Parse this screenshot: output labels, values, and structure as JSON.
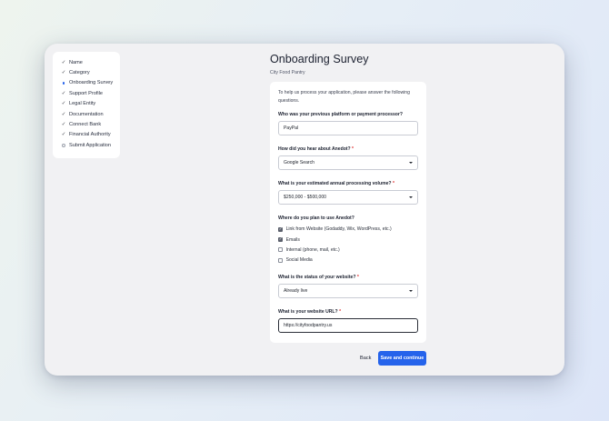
{
  "sidebar": {
    "steps": [
      {
        "label": "Name",
        "state": "done"
      },
      {
        "label": "Category",
        "state": "done"
      },
      {
        "label": "Onboarding Survey",
        "state": "current"
      },
      {
        "label": "Support Profile",
        "state": "done"
      },
      {
        "label": "Legal Entity",
        "state": "done"
      },
      {
        "label": "Documentation",
        "state": "done"
      },
      {
        "label": "Connect Bank",
        "state": "done"
      },
      {
        "label": "Financial Authority",
        "state": "done"
      },
      {
        "label": "Submit Application",
        "state": "pending"
      }
    ]
  },
  "header": {
    "title": "Onboarding Survey",
    "subtitle": "City Food Pantry"
  },
  "form": {
    "intro": "To help us process your application, please answer the following questions.",
    "q1": {
      "label": "Who was your previous platform or payment processor?",
      "value": "PayPal"
    },
    "q2": {
      "label": "How did you hear about Anedot?",
      "required_mark": "*",
      "value": "Google Search"
    },
    "q3": {
      "label": "What is your estimated annual processing volume?",
      "required_mark": "*",
      "value": "$250,000 - $500,000"
    },
    "q4": {
      "label": "Where do you plan to use Anedot?",
      "options": [
        {
          "label": "Link from Website (Godaddy, Wix, WordPress, etc.)",
          "checked": true
        },
        {
          "label": "Emails",
          "checked": true
        },
        {
          "label": "Internal (phone, mail, etc.)",
          "checked": false
        },
        {
          "label": "Social Media",
          "checked": false
        }
      ]
    },
    "q5": {
      "label": "What is the status of your website?",
      "required_mark": "*",
      "value": "Already live"
    },
    "q6": {
      "label": "What is your website URL?",
      "required_mark": "*",
      "value": "https://cityfoodpantry.us"
    }
  },
  "actions": {
    "back_label": "Back",
    "continue_label": "Save and continue"
  },
  "colors": {
    "accent": "#2563eb",
    "required": "#e03131"
  }
}
